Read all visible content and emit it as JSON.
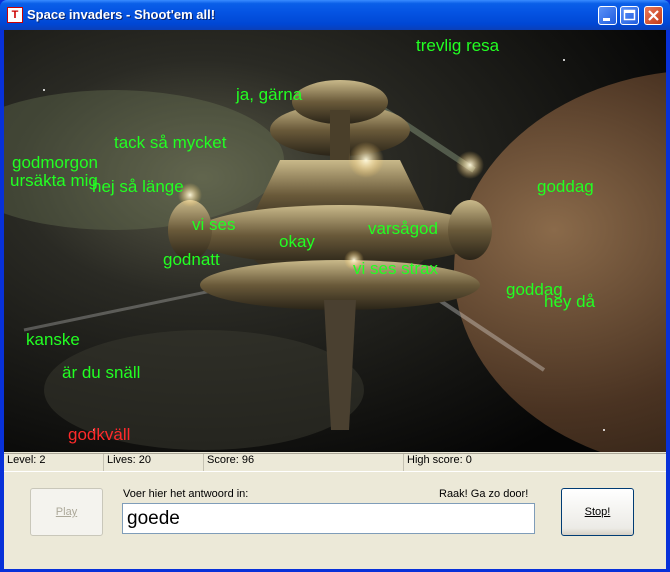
{
  "window": {
    "title": "Space invaders - Shoot'em all!",
    "icon": "app-icon",
    "controls": [
      "minimize-icon",
      "maximize-icon",
      "close-icon"
    ]
  },
  "game": {
    "words": [
      {
        "text": "trevlig resa",
        "state": "falling"
      },
      {
        "text": "ja, gärna",
        "state": "falling"
      },
      {
        "text": "tack så mycket",
        "state": "falling"
      },
      {
        "text": "godmorgon",
        "state": "falling"
      },
      {
        "text": "ursäkta mig",
        "state": "falling"
      },
      {
        "text": "hej så länge",
        "state": "falling"
      },
      {
        "text": "goddag",
        "state": "falling"
      },
      {
        "text": "vi ses",
        "state": "falling"
      },
      {
        "text": "okay",
        "state": "falling"
      },
      {
        "text": "varsågod",
        "state": "falling"
      },
      {
        "text": "godnatt",
        "state": "falling"
      },
      {
        "text": "vi ses strax",
        "state": "falling"
      },
      {
        "text": "goddag",
        "state": "falling"
      },
      {
        "text": "hey då",
        "state": "falling"
      },
      {
        "text": "kanske",
        "state": "falling"
      },
      {
        "text": "är du snäll",
        "state": "falling"
      },
      {
        "text": "godkväll",
        "state": "target"
      }
    ],
    "colors": {
      "word": "#22ff22",
      "target_word": "#ff2a2a"
    }
  },
  "statusbar": {
    "level": "Level: 2",
    "lives": "Lives: 20",
    "score": "Score: 96",
    "high_score": "High score: 0"
  },
  "controls": {
    "play_label": "Play",
    "stop_label": "Stop!",
    "prompt_label": "Voer hier het antwoord in:",
    "feedback": "Raak! Ga zo door!",
    "answer_value": "goede"
  }
}
